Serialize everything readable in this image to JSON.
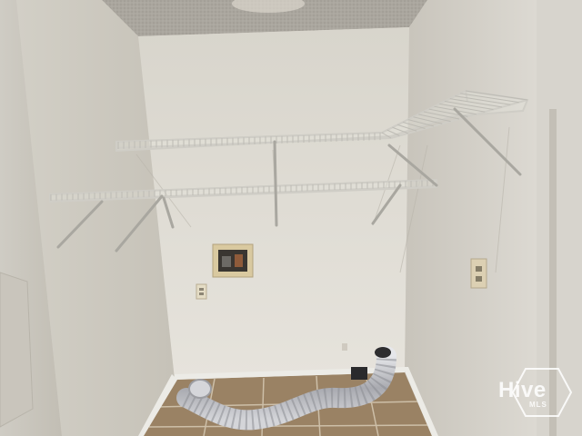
{
  "photo": {
    "subject": "laundry-room",
    "colors": {
      "wall_back": "#dedbd2",
      "wall_side": "#d3cfc6",
      "ceiling": "#a9a59d",
      "floor_tile": "#9a8264",
      "shelf_wire": "#c9c7c0",
      "duct": "#b8b9bd"
    }
  },
  "watermark": {
    "brand": "Hive",
    "suffix": "MLS"
  }
}
